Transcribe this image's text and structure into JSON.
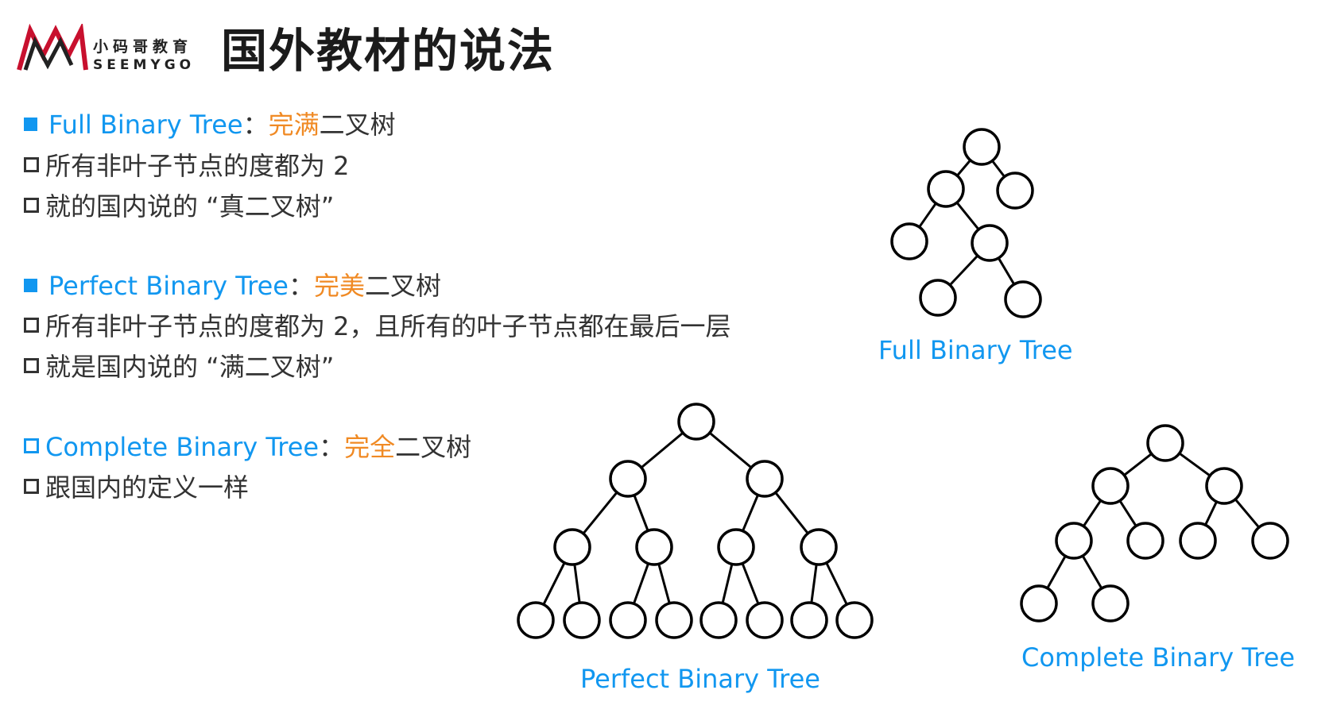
{
  "logo": {
    "cn": "小码哥教育",
    "en": "SEEMYGO"
  },
  "title": "国外教材的说法",
  "sections": [
    {
      "en": "Full Binary Tree",
      "sep": "：",
      "hi": "完满",
      "rest": "二叉树",
      "items": [
        "所有非叶子节点的度都为 2",
        "就的国内说的 “真二叉树”"
      ]
    },
    {
      "en": "Perfect Binary Tree",
      "sep": "：",
      "hi": "完美",
      "rest": "二叉树",
      "items": [
        "所有非叶子节点的度都为 2，且所有的叶子节点都在最后一层",
        "就是国内说的 “满二叉树”"
      ]
    },
    {
      "en": "Complete Binary Tree",
      "sep": "：",
      "hi": "完全",
      "rest": "二叉树",
      "items": [
        "跟国内的定义一样"
      ]
    }
  ],
  "captions": {
    "full": "Full Binary Tree",
    "perfect": "Perfect Binary Tree",
    "complete": "Complete Binary Tree"
  },
  "colors": {
    "accent_blue": "#1197f0",
    "highlight_orange": "#f08a24",
    "logo_red": "#c8102e"
  }
}
